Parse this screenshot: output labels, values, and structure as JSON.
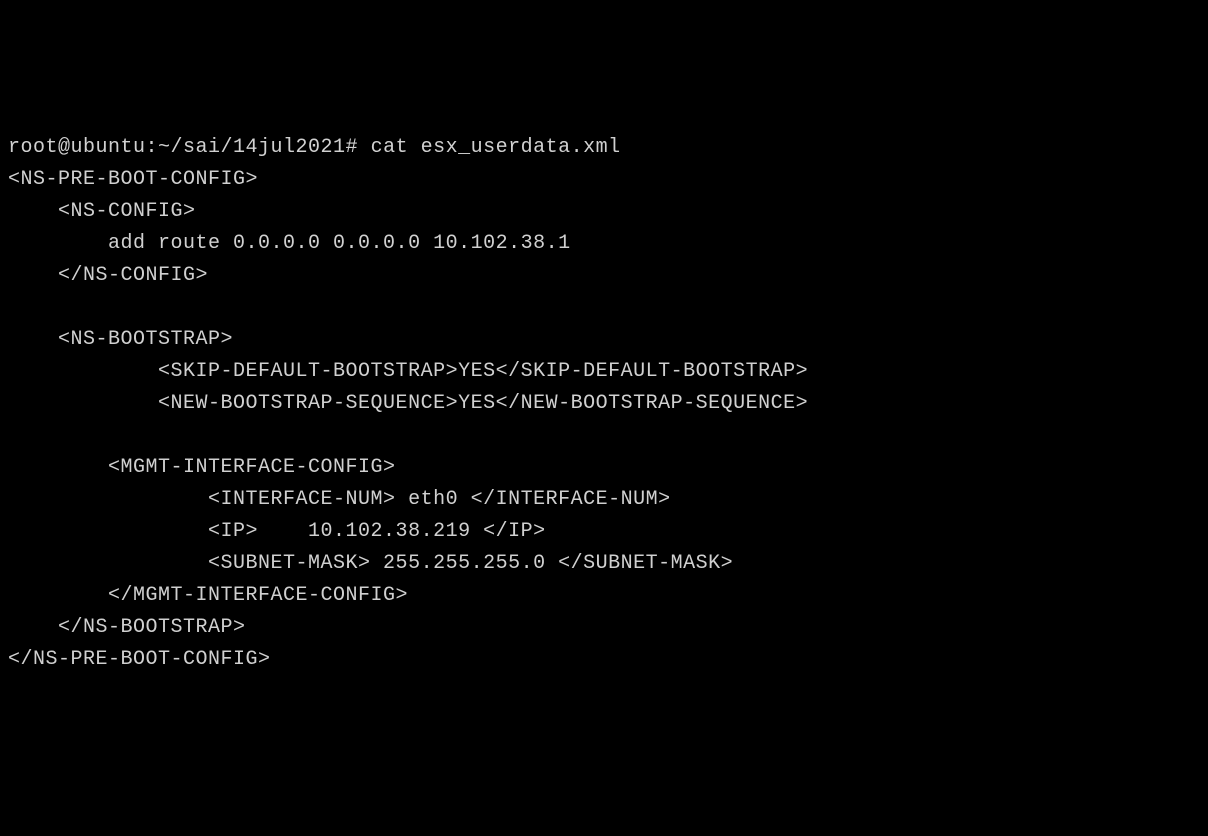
{
  "terminal": {
    "prompt": "root@ubuntu:~/sai/14jul2021# ",
    "command": "cat esx_userdata.xml",
    "lines": {
      "l01": "<NS-PRE-BOOT-CONFIG>",
      "l02": "    <NS-CONFIG>",
      "l03": "        add route 0.0.0.0 0.0.0.0 10.102.38.1",
      "l04": "    </NS-CONFIG>",
      "l05": "",
      "l06": "    <NS-BOOTSTRAP>",
      "l07": "            <SKIP-DEFAULT-BOOTSTRAP>YES</SKIP-DEFAULT-BOOTSTRAP>",
      "l08": "            <NEW-BOOTSTRAP-SEQUENCE>YES</NEW-BOOTSTRAP-SEQUENCE>",
      "l09": "",
      "l10": "        <MGMT-INTERFACE-CONFIG>",
      "l11": "                <INTERFACE-NUM> eth0 </INTERFACE-NUM>",
      "l12": "                <IP>    10.102.38.219 </IP>",
      "l13": "                <SUBNET-MASK> 255.255.255.0 </SUBNET-MASK>",
      "l14": "        </MGMT-INTERFACE-CONFIG>",
      "l15": "    </NS-BOOTSTRAP>",
      "l16": "</NS-PRE-BOOT-CONFIG>"
    }
  }
}
